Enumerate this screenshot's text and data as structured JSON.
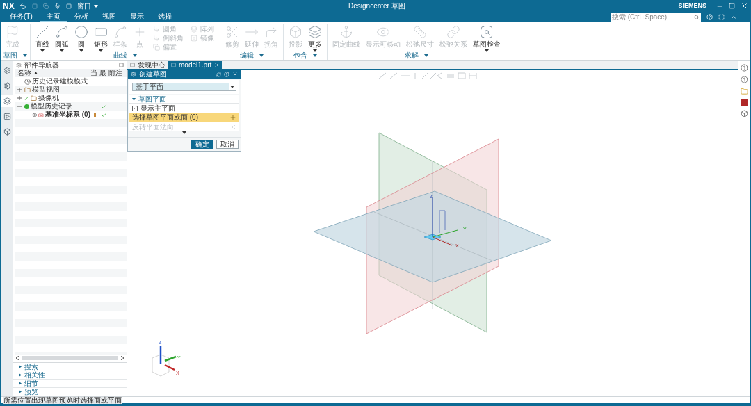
{
  "quick_access": {
    "app": "NX",
    "window_menu": "窗口"
  },
  "title_bar": {
    "title": "Designcenter 草图",
    "brand": "SIEMENS"
  },
  "menu_tabs": [
    {
      "label": "任务(T)",
      "selected": false
    },
    {
      "label": "主页",
      "selected": true
    },
    {
      "label": "分析",
      "selected": false
    },
    {
      "label": "视图",
      "selected": false
    },
    {
      "label": "显示",
      "selected": false
    },
    {
      "label": "选择",
      "selected": false
    }
  ],
  "search": {
    "placeholder": "搜索 (Ctrl+Space)"
  },
  "ribbon_groups": [
    {
      "label": "草图",
      "items": [
        {
          "label": "完成",
          "kind": "large",
          "disabled": true,
          "has_menu": false
        }
      ]
    },
    {
      "label": "曲线",
      "items": [
        {
          "label": "直线",
          "kind": "large",
          "disabled": false,
          "has_menu": true
        },
        {
          "label": "圆弧",
          "kind": "large",
          "disabled": false,
          "has_menu": true
        },
        {
          "label": "圆",
          "kind": "large",
          "disabled": false,
          "has_menu": true
        },
        {
          "label": "矩形",
          "kind": "large",
          "disabled": false,
          "has_menu": true
        },
        {
          "label": "样条",
          "kind": "large",
          "disabled": true,
          "has_menu": false
        },
        {
          "label": "点",
          "kind": "large",
          "disabled": true,
          "has_menu": false
        },
        {
          "label": "圆角",
          "kind": "small",
          "disabled": true
        },
        {
          "label": "倒斜角",
          "kind": "small",
          "disabled": true
        },
        {
          "label": "偏置",
          "kind": "small",
          "disabled": true
        },
        {
          "label": "阵列",
          "kind": "small",
          "disabled": true
        },
        {
          "label": "镜像",
          "kind": "small",
          "disabled": true
        }
      ]
    },
    {
      "label": "编辑",
      "items": [
        {
          "label": "修剪",
          "kind": "large",
          "disabled": true,
          "has_menu": false
        },
        {
          "label": "延伸",
          "kind": "large",
          "disabled": true,
          "has_menu": false
        },
        {
          "label": "拐角",
          "kind": "large",
          "disabled": true,
          "has_menu": false
        }
      ]
    },
    {
      "label": "包含",
      "items": [
        {
          "label": "投影",
          "kind": "large",
          "disabled": true,
          "has_menu": false
        },
        {
          "label": "更多",
          "kind": "large",
          "disabled": false,
          "has_menu": true
        }
      ]
    },
    {
      "label": "求解",
      "items": [
        {
          "label": "固定曲线",
          "kind": "large",
          "disabled": true,
          "has_menu": false
        },
        {
          "label": "显示可移动",
          "kind": "large",
          "disabled": true,
          "has_menu": false
        },
        {
          "label": "松弛尺寸",
          "kind": "large",
          "disabled": true,
          "has_menu": false
        },
        {
          "label": "松弛关系",
          "kind": "large",
          "disabled": true,
          "has_menu": false
        },
        {
          "label": "草图检查",
          "kind": "large",
          "disabled": false,
          "has_menu": true
        }
      ]
    }
  ],
  "resource_bar": [
    {
      "selected": false
    },
    {
      "selected": false
    },
    {
      "selected": true
    },
    {
      "selected": false
    },
    {
      "selected": false
    }
  ],
  "navigator": {
    "title": "部件导航器",
    "columns": [
      "名称",
      "当",
      "最",
      "附注"
    ],
    "rows": [
      {
        "name": "历史记录建模模式",
        "kind": "mode"
      },
      {
        "name": "模型视图",
        "kind": "folder",
        "expanded": false
      },
      {
        "name": "摄像机",
        "kind": "folder",
        "expanded": false,
        "visible": true
      },
      {
        "name": "模型历史记录",
        "kind": "folder",
        "expanded": true,
        "latest": true,
        "children": [
          {
            "name": "基准坐标系 (0)",
            "kind": "feature",
            "current": true,
            "latest": true,
            "visible": true
          }
        ]
      }
    ]
  },
  "accordion": [
    {
      "label": "搜索",
      "expanded": false
    },
    {
      "label": "相关性",
      "expanded": false
    },
    {
      "label": "细节",
      "expanded": false
    },
    {
      "label": "预览",
      "expanded": false
    }
  ],
  "viewport_tabs": [
    {
      "label": "发现中心",
      "selected": false
    },
    {
      "label": "model1.prt",
      "selected": true
    }
  ],
  "dialog": {
    "title": "创建草图",
    "type_value": "基于平面",
    "section": {
      "label": "草图平面",
      "expanded": true
    },
    "show_main_plane": {
      "label": "显示主平面",
      "checked": true
    },
    "select_row": {
      "label": "选择草图平面或面 (0)",
      "selected": true
    },
    "reverse": {
      "label": "反转平面法向",
      "disabled": true
    },
    "buttons": [
      {
        "label": "确定",
        "kind": "primary"
      },
      {
        "label": "取消",
        "kind": "secondary"
      }
    ]
  },
  "datum_axes": {
    "z": "Z",
    "y": "Y",
    "x": "X"
  },
  "triad": {
    "z": "Z",
    "y": "Y",
    "x": "X"
  },
  "status": "所需位置出现草图预览时选择面或平面"
}
